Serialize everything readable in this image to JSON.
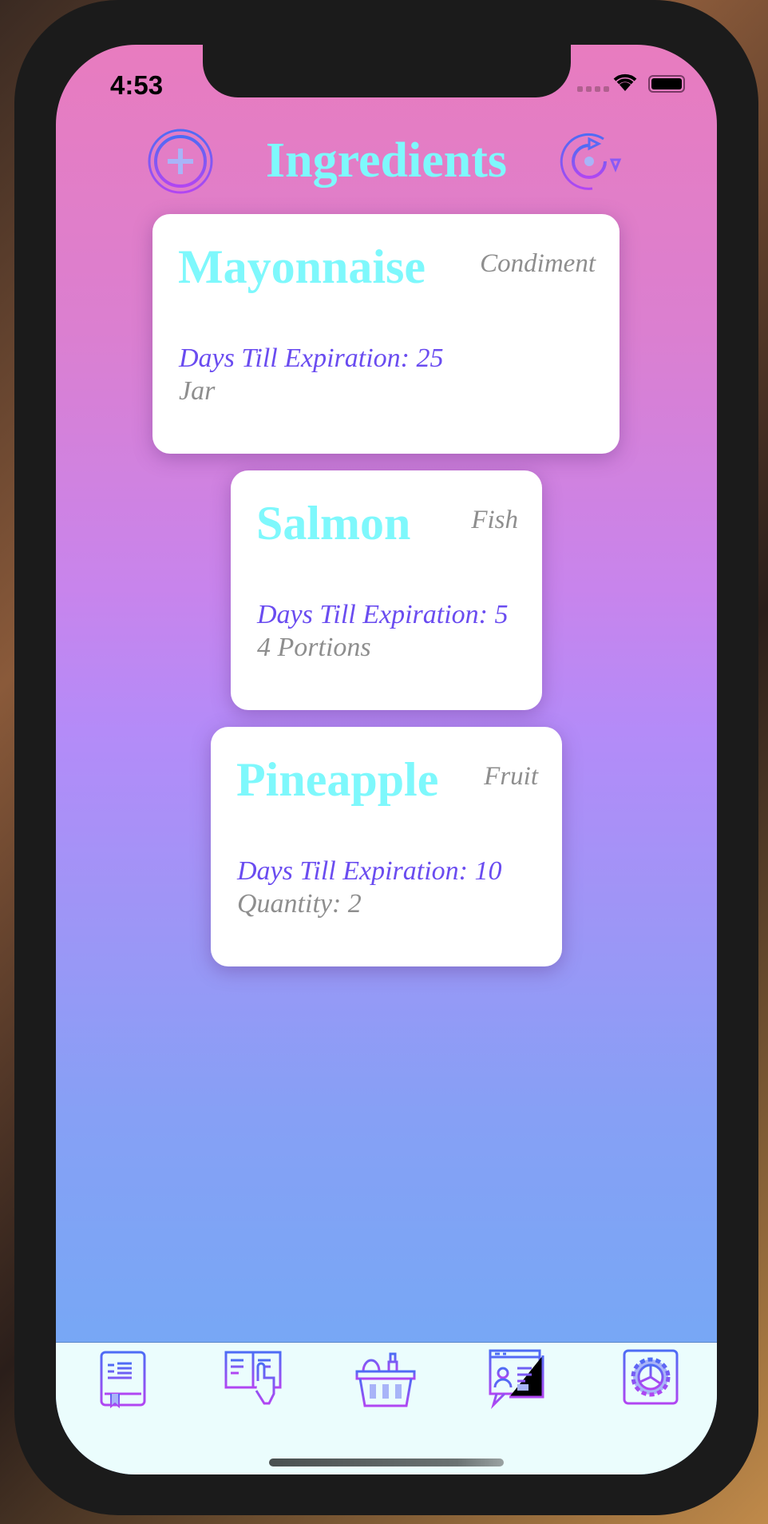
{
  "status": {
    "time": "4:53"
  },
  "header": {
    "title": "Ingredients",
    "add_icon": "plus-circle-icon",
    "refresh_icon": "refresh-icon"
  },
  "ingredients": [
    {
      "name": "Mayonnaise",
      "category": "Condiment",
      "days": "Days Till Expiration: 25",
      "quantity": "Jar"
    },
    {
      "name": "Salmon",
      "category": "Fish",
      "days": "Days Till Expiration: 5",
      "quantity": "4 Portions"
    },
    {
      "name": "Pineapple",
      "category": "Fruit",
      "days": "Days Till Expiration: 10",
      "quantity": "Quantity: 2"
    }
  ],
  "tabs": [
    "recipe-book-icon",
    "cookbook-touch-icon",
    "grocery-basket-icon",
    "profile-browser-icon",
    "settings-gear-icon"
  ],
  "colors": {
    "title": "#7ef8fc",
    "days": "#6a4cf0",
    "gray": "#8e8e8e",
    "tabbar": "#ebfdfd",
    "gradient_top": "#e87cbf",
    "gradient_bottom": "#76a8f5"
  }
}
